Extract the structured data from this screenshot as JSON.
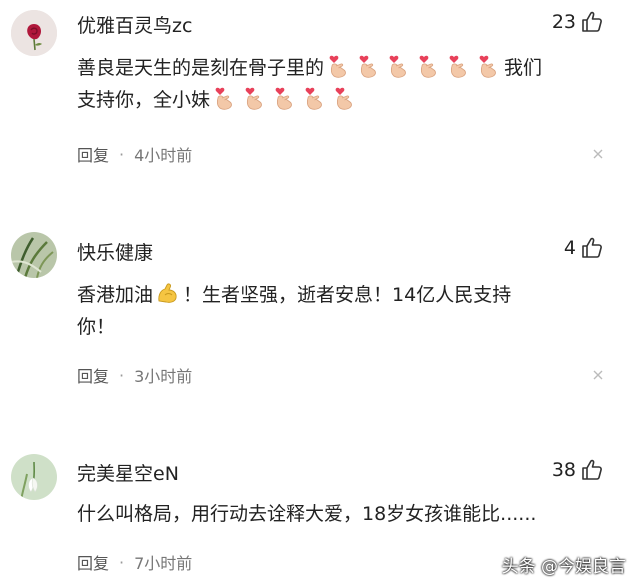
{
  "comments": [
    {
      "author": "优雅百灵鸟zc",
      "likes": "23",
      "text_a": "善良是天生的是刻在骨子里的",
      "text_b": "我们",
      "text_c": "支持你，全小妹",
      "reply_label": "回复",
      "time": "4小时前",
      "avatar_icon": "red-rose-avatar"
    },
    {
      "author": "快乐健康",
      "likes": "4",
      "text_a": "香港加油",
      "text_b": "！生者坚强，逝者安息！14亿人民支持",
      "text_c": "你！",
      "reply_label": "回复",
      "time": "3小时前",
      "avatar_icon": "grass-avatar"
    },
    {
      "author": "完美星空eN",
      "likes": "38",
      "text_a": "什么叫格局，用行动去诠释大爱，18岁女孩谁能比......",
      "reply_label": "回复",
      "time": "7小时前",
      "avatar_icon": "snowdrop-flower-avatar"
    }
  ],
  "watermark": "头条 @今娱良言",
  "colors": {
    "text": "#222222",
    "meta": "#777777",
    "emoji_heart": "#e8415a"
  }
}
